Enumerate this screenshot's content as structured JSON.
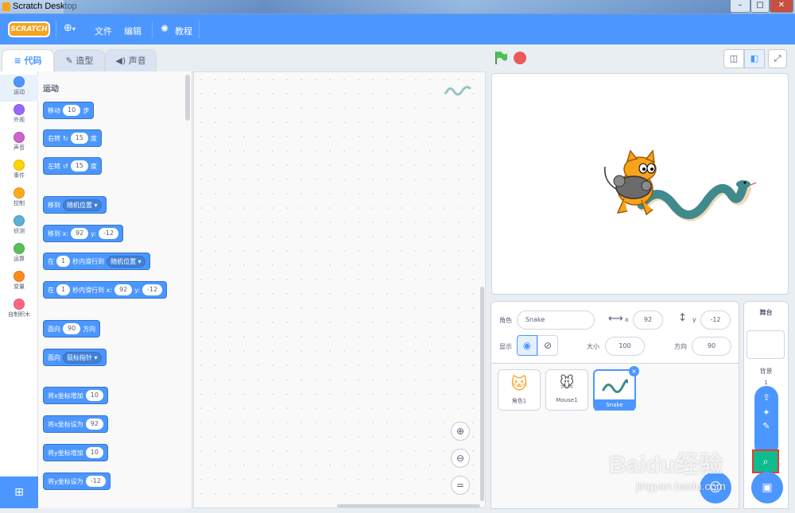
{
  "window": {
    "title": "Scratch Desktop"
  },
  "menubar": {
    "logo": "SCRATCH",
    "file": "文件",
    "edit": "编辑",
    "tutorials": "教程"
  },
  "tabs": [
    {
      "label": "代码"
    },
    {
      "label": "造型"
    },
    {
      "label": "声音"
    }
  ],
  "categories": [
    {
      "label": "运动",
      "color": "#4c97ff"
    },
    {
      "label": "外观",
      "color": "#9966ff"
    },
    {
      "label": "声音",
      "color": "#cf63cf"
    },
    {
      "label": "事件",
      "color": "#ffd500"
    },
    {
      "label": "控制",
      "color": "#ffab19"
    },
    {
      "label": "侦测",
      "color": "#5cb1d6"
    },
    {
      "label": "运算",
      "color": "#59c059"
    },
    {
      "label": "变量",
      "color": "#ff8c1a"
    },
    {
      "label": "自制积木",
      "color": "#ff6680"
    }
  ],
  "palette": {
    "heading": "运动",
    "move": {
      "a": "移动",
      "v": "10",
      "b": "步"
    },
    "turn_right": {
      "a": "右转",
      "v": "15",
      "b": "度"
    },
    "turn_left": {
      "a": "左转",
      "v": "15",
      "b": "度"
    },
    "goto": {
      "a": "移到",
      "dd": "随机位置"
    },
    "goto_xy": {
      "a": "移到 x:",
      "x": "92",
      "y_label": "y:",
      "y": "-12"
    },
    "glide": {
      "a": "在",
      "v": "1",
      "b": "秒内滑行到",
      "dd": "随机位置"
    },
    "glide_xy": {
      "a": "在",
      "v": "1",
      "b": "秒内滑行到 x:",
      "x": "92",
      "y_label": "y:",
      "y": "-12"
    },
    "point_dir": {
      "a": "面向",
      "v": "90",
      "b": "方向"
    },
    "point_towards": {
      "a": "面向",
      "dd": "鼠标指针"
    },
    "change_x": {
      "a": "将x坐标增加",
      "v": "10"
    },
    "set_x": {
      "a": "将x坐标设为",
      "v": "92"
    },
    "change_y": {
      "a": "将y坐标增加",
      "v": "10"
    },
    "set_y": {
      "a": "将y坐标设为",
      "v": "-12"
    }
  },
  "sprite_info": {
    "sprite_label": "角色",
    "sprite_name": "Snake",
    "x_label": "x",
    "x": "92",
    "y_label": "y",
    "y": "-12",
    "show_label": "显示",
    "size_label": "大小",
    "size": "100",
    "direction_label": "方向",
    "direction": "90"
  },
  "sprites": [
    {
      "name": "角色1"
    },
    {
      "name": "Mouse1"
    },
    {
      "name": "Snake"
    }
  ],
  "stage_panel": {
    "title": "舞台",
    "backdrops_label": "背景",
    "backdrops_count": "1"
  },
  "watermark": {
    "brand": "Baidu经验",
    "url": "jingyan.baidu.com"
  },
  "colors": {
    "accent": "#4c97ff",
    "green_flag": "#4cbf56",
    "stop": "#ec5959",
    "search_btn": "#0fbd8c"
  }
}
